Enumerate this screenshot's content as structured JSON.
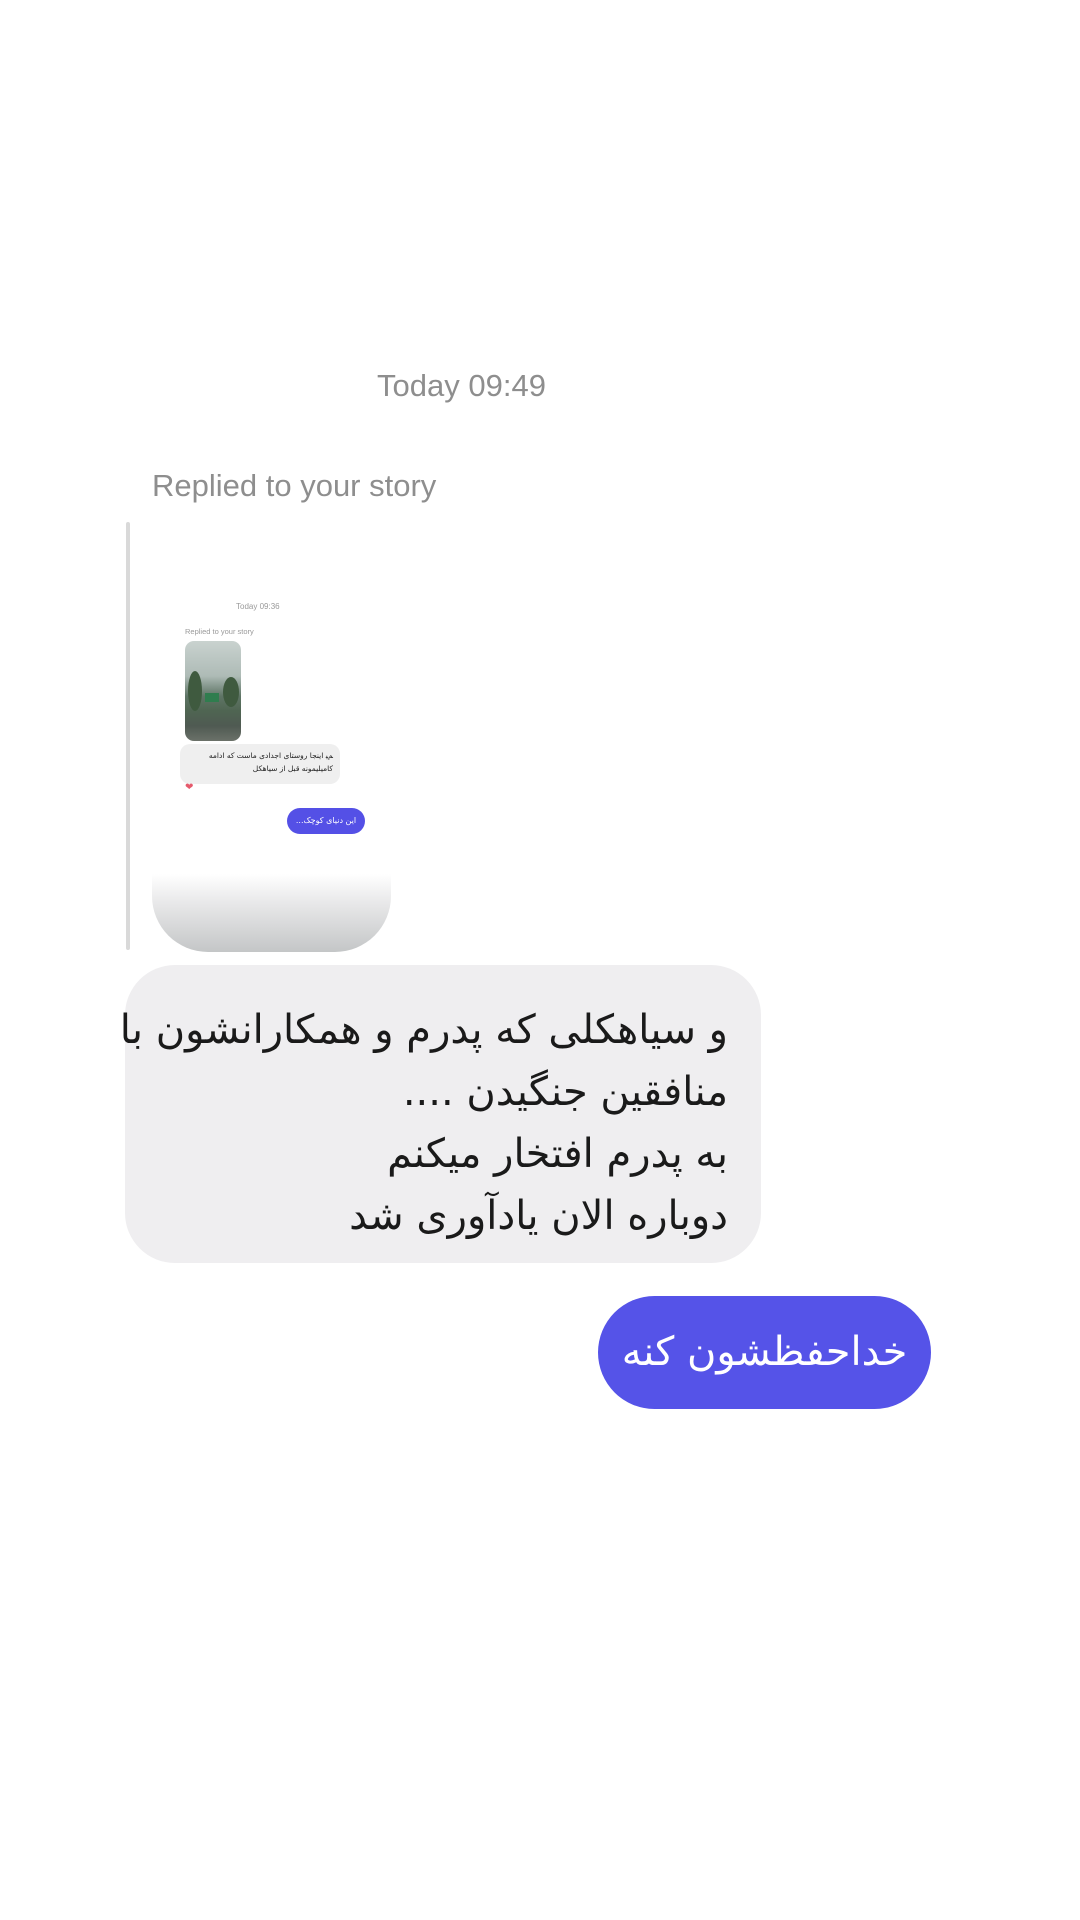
{
  "conversation": {
    "timestamp": "Today 09:49",
    "story_reply": {
      "label": "Replied to your story",
      "preview": {
        "timestamp": "Today 09:36",
        "replied_label": "Replied to your story",
        "message": "ﻢﯿ اینجا روستای اجدادی ماست که ادامه کامیلیمونه قبل از سیاهکل",
        "reaction": "❤",
        "sent_message": "این دنیای کوچک..."
      }
    },
    "received_message": {
      "lines": [
        "و سیاهکلی که پدرم و همکارانشون با",
        "منافقین جنگیدن ....",
        "به پدرم افتخار میکنم",
        "دوباره الان یادآوری شد"
      ]
    },
    "sent_message": {
      "text": "خداحفظشون کنه"
    }
  },
  "colors": {
    "sent_bubble": "#5553e8",
    "received_bubble": "#efeef0",
    "meta_text": "#8e8e8e"
  }
}
